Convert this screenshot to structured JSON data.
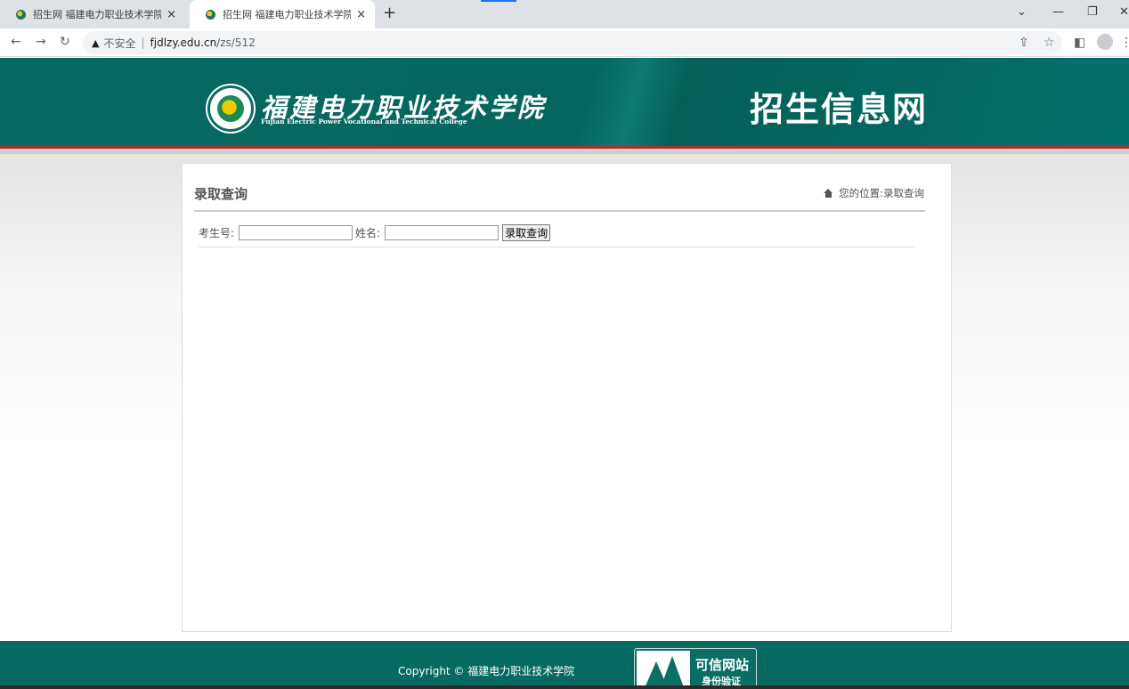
{
  "browser": {
    "tabs": [
      {
        "title": "招生网 福建电力职业技术学院"
      },
      {
        "title": "招生网 福建电力职业技术学院"
      }
    ],
    "new_tab": "+",
    "tab_close": "×",
    "security_label": "不安全",
    "url_host": "fjdlzy.edu.cn",
    "url_path": "/zs/512"
  },
  "header": {
    "college_name_cn": "福建电力职业技术学院",
    "college_name_en": "Fujian Electric Power Vocational and Technical College",
    "site_title": "招生信息网"
  },
  "main": {
    "section_title": "录取查询",
    "breadcrumb_prefix": "您的位置:",
    "breadcrumb_current": "录取查询",
    "query": {
      "exam_no_label": "考生号:",
      "exam_no_value": "",
      "name_label": "姓名:",
      "name_value": "",
      "submit_label": "录取查询"
    }
  },
  "footer": {
    "copyright": "Copyright © 福建电力职业技术学院",
    "badge_main": "可信网站",
    "badge_sub": "身份验证"
  }
}
